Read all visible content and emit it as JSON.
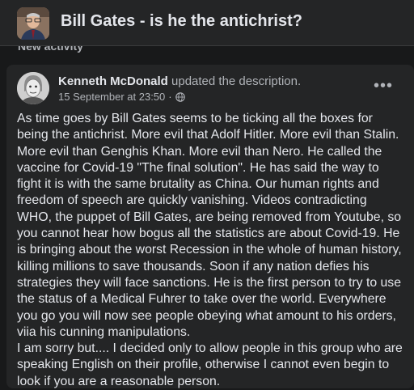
{
  "header": {
    "group_title": "Bill Gates - is he the antichrist?",
    "section_label": "New activity"
  },
  "post": {
    "author": "Kenneth McDonald",
    "action": "updated the description.",
    "timestamp": "15 September at 23:50",
    "separator": "·",
    "privacy_icon": "globe-icon",
    "more_icon": "more-options-icon",
    "paragraphs": [
      "As time goes by Bill Gates seems to be ticking all the boxes for being the antichrist. More evil that Adolf Hitler. More evil than Stalin. More evil than Genghis Khan. More evil than Nero. He called the vaccine for Covid-19 \"The final solution\". He has said the way to fight it is with the same brutality as China. Our human rights and freedom of speech are quickly vanishing. Videos contradicting WHO, the puppet of Bill Gates, are being removed from Youtube, so you cannot hear how bogus all the statistics are about Covid-19. He is bringing about the worst Recession in the whole of human history, killing millions to save thousands. Soon if any nation defies his strategies they will face sanctions. He is the first person to try to use the status of a Medical Fuhrer to take over the world. Everywhere you go you will now see people obeying what amount to his orders, viia his cunning manipulations.",
      "I am sorry but.... I decided only to allow people in this group who are speaking English on their profile, otherwise I cannot even begin to look if you are a reasonable person."
    ]
  },
  "colors": {
    "page_bg": "#18191a",
    "card_bg": "#242526",
    "primary_text": "#e4e6eb",
    "secondary_text": "#b0b3b8"
  }
}
